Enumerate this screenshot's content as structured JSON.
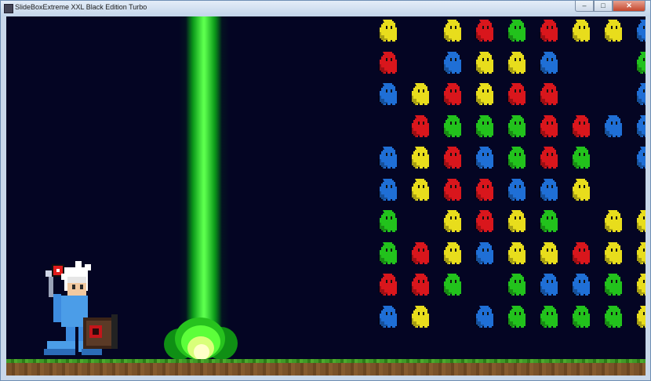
{
  "window": {
    "title": "SlideBoxExtreme XXL Black Edition Turbo",
    "minimize_icon": "minimize-icon",
    "maximize_icon": "maximize-icon",
    "close_icon": "close-icon",
    "minimize_glyph": "–",
    "maximize_glyph": "□",
    "close_glyph": "✕"
  },
  "colors": {
    "background": "#040523",
    "beam": "#3dff2e",
    "ground_grass": "#3f9a26",
    "ground_dirt": "#7a5229",
    "yellow": "#e8dd1c",
    "red": "#d9161c",
    "green": "#22c21c",
    "blue": "#1f6fd6"
  },
  "game": {
    "enemy_grid": {
      "columns": 9,
      "rows": 10,
      "cells": [
        [
          "yellow",
          null,
          "yellow",
          "red",
          "green",
          "red",
          "yellow",
          "yellow",
          "blue"
        ],
        [
          "red",
          null,
          "blue",
          "yellow",
          "yellow",
          "blue",
          null,
          null,
          "green"
        ],
        [
          "blue",
          "yellow",
          "red",
          "yellow",
          "red",
          "red",
          null,
          null,
          "blue"
        ],
        [
          null,
          "red",
          "green",
          "green",
          "green",
          "red",
          "red",
          "blue",
          "blue"
        ],
        [
          "blue",
          "yellow",
          "red",
          "blue",
          "green",
          "red",
          "green",
          null,
          "blue"
        ],
        [
          "blue",
          "yellow",
          "red",
          "red",
          "blue",
          "blue",
          "yellow",
          null,
          null
        ],
        [
          "green",
          null,
          "yellow",
          "red",
          "yellow",
          "green",
          null,
          "yellow",
          "yellow"
        ],
        [
          "green",
          "red",
          "yellow",
          "blue",
          "yellow",
          "yellow",
          "red",
          "yellow",
          "yellow"
        ],
        [
          "red",
          "red",
          "green",
          null,
          "green",
          "blue",
          "blue",
          "green",
          "yellow"
        ],
        [
          "blue",
          "yellow",
          null,
          "blue",
          "green",
          "green",
          "green",
          "green",
          "yellow"
        ]
      ]
    }
  }
}
